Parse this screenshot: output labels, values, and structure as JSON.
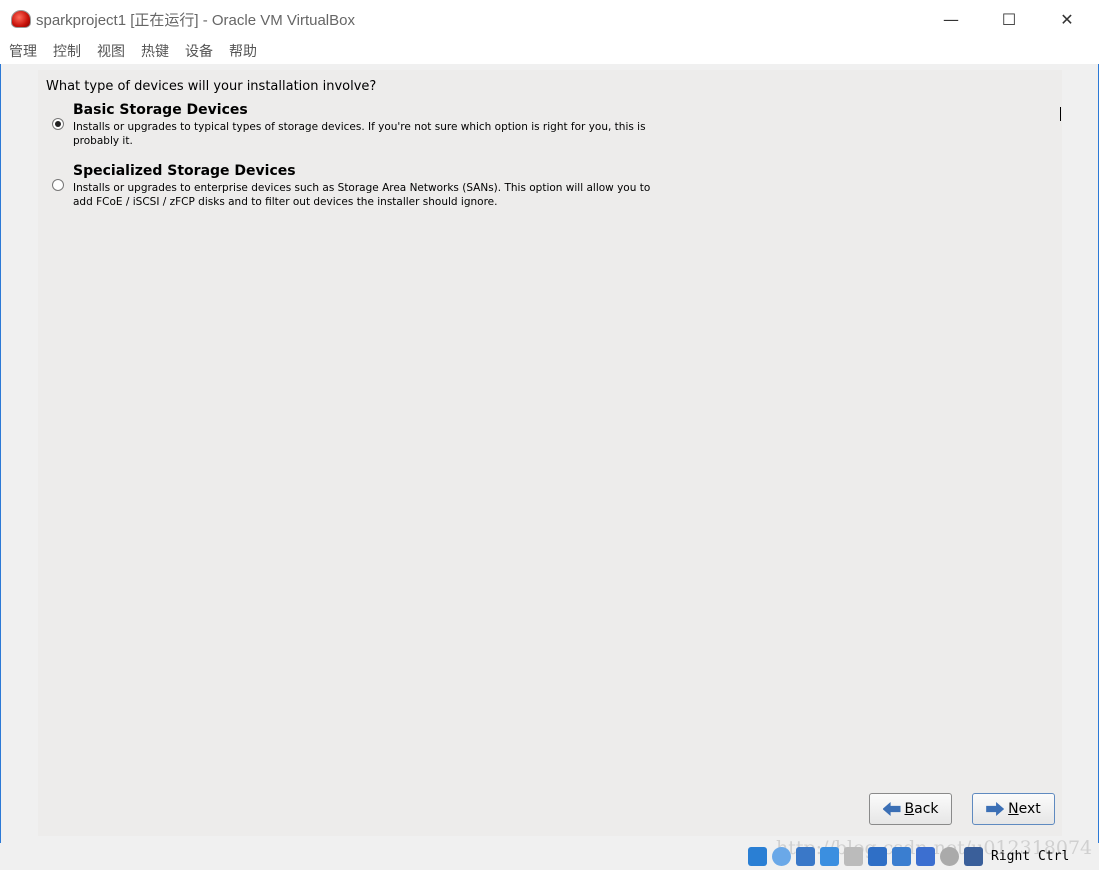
{
  "window": {
    "title": "sparkproject1 [正在运行] - Oracle VM VirtualBox",
    "controls": [
      "minimize",
      "maximize",
      "close"
    ]
  },
  "menu": [
    "管理",
    "控制",
    "视图",
    "热键",
    "设备",
    "帮助"
  ],
  "installer": {
    "question": "What type of devices will your installation involve?",
    "options": [
      {
        "title": "Basic Storage Devices",
        "description": "Installs or upgrades to typical types of storage devices.  If you're not sure which option is right for you, this is probably it.",
        "selected": true
      },
      {
        "title": "Specialized Storage Devices",
        "description": "Installs or upgrades to enterprise devices such as Storage Area Networks (SANs). This option will allow you to add FCoE / iSCSI / zFCP disks and to filter out devices the installer should ignore.",
        "selected": false
      }
    ],
    "back_first": "B",
    "back_rest": "ack",
    "next_first": "N",
    "next_rest": "ext"
  },
  "statusbar": {
    "host_key": "Right Ctrl",
    "icons": [
      "hard-disk-icon",
      "optical-drive-icon",
      "network-icon",
      "usb-icon",
      "shared-folders-icon",
      "display-icon",
      "video-capture-icon",
      "cpu-virtualization-icon",
      "mouse-integration-icon",
      "keyboard-capture-icon"
    ],
    "icon_colors": [
      "#2a7fd4",
      "#6aa8e8",
      "#3a78c8",
      "#3b8fe0",
      "#bbbbbb",
      "#2f6fc6",
      "#3a7ed0",
      "#3c6fd0",
      "#aaaaaa",
      "#3a5f9a"
    ]
  },
  "watermark": "http://blog.csdn.net/u012318074"
}
